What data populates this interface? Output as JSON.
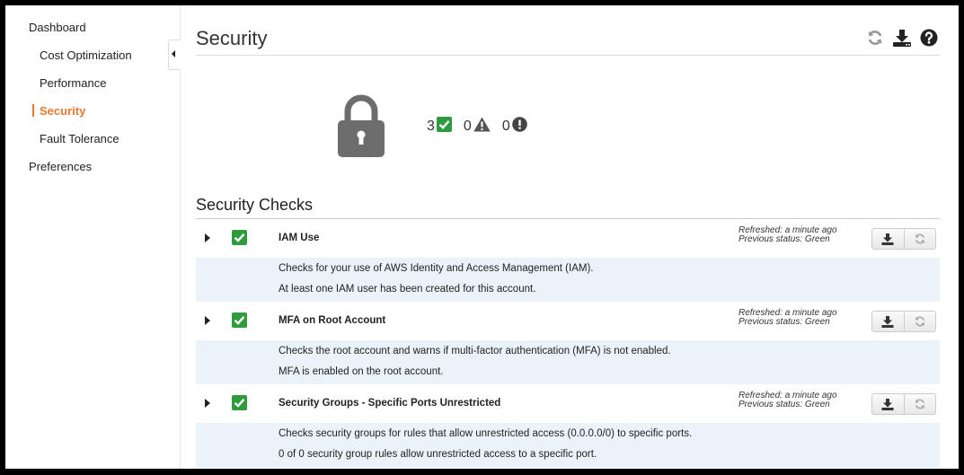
{
  "sidebar": {
    "items": [
      {
        "label": "Dashboard",
        "level": "top",
        "active": false
      },
      {
        "label": "Cost Optimization",
        "level": "sub",
        "active": false
      },
      {
        "label": "Performance",
        "level": "sub",
        "active": false
      },
      {
        "label": "Security",
        "level": "sub",
        "active": true
      },
      {
        "label": "Fault Tolerance",
        "level": "sub",
        "active": false
      },
      {
        "label": "Preferences",
        "level": "top",
        "active": false
      }
    ]
  },
  "page": {
    "title": "Security",
    "header_icons": [
      "refresh-icon",
      "download-icon",
      "help-icon"
    ]
  },
  "summary": {
    "icon": "lock-icon",
    "ok_count": "3",
    "warning_count": "0",
    "error_count": "0"
  },
  "checks": {
    "title": "Security Checks",
    "rows": [
      {
        "title": "IAM Use",
        "status": "ok",
        "refreshed": "Refreshed: a minute ago",
        "previous_status": "Previous status: Green",
        "description": "Checks for your use of AWS Identity and Access Management (IAM).",
        "result": "At least one IAM user has been created for this account."
      },
      {
        "title": "MFA on Root Account",
        "status": "ok",
        "refreshed": "Refreshed: a minute ago",
        "previous_status": "Previous status: Green",
        "description": "Checks the root account and warns if multi-factor authentication (MFA) is not enabled.",
        "result": "MFA is enabled on the root account."
      },
      {
        "title": "Security Groups - Specific Ports Unrestricted",
        "status": "ok",
        "refreshed": "Refreshed: a minute ago",
        "previous_status": "Previous status: Green",
        "description": "Checks security groups for rules that allow unrestricted access (0.0.0.0/0) to specific ports.",
        "result": "0 of 0 security group rules allow unrestricted access to a specific port."
      }
    ]
  },
  "colors": {
    "accent": "#e8792c",
    "ok": "#2e9b3d",
    "detail_bg": "#eaf3fa"
  }
}
